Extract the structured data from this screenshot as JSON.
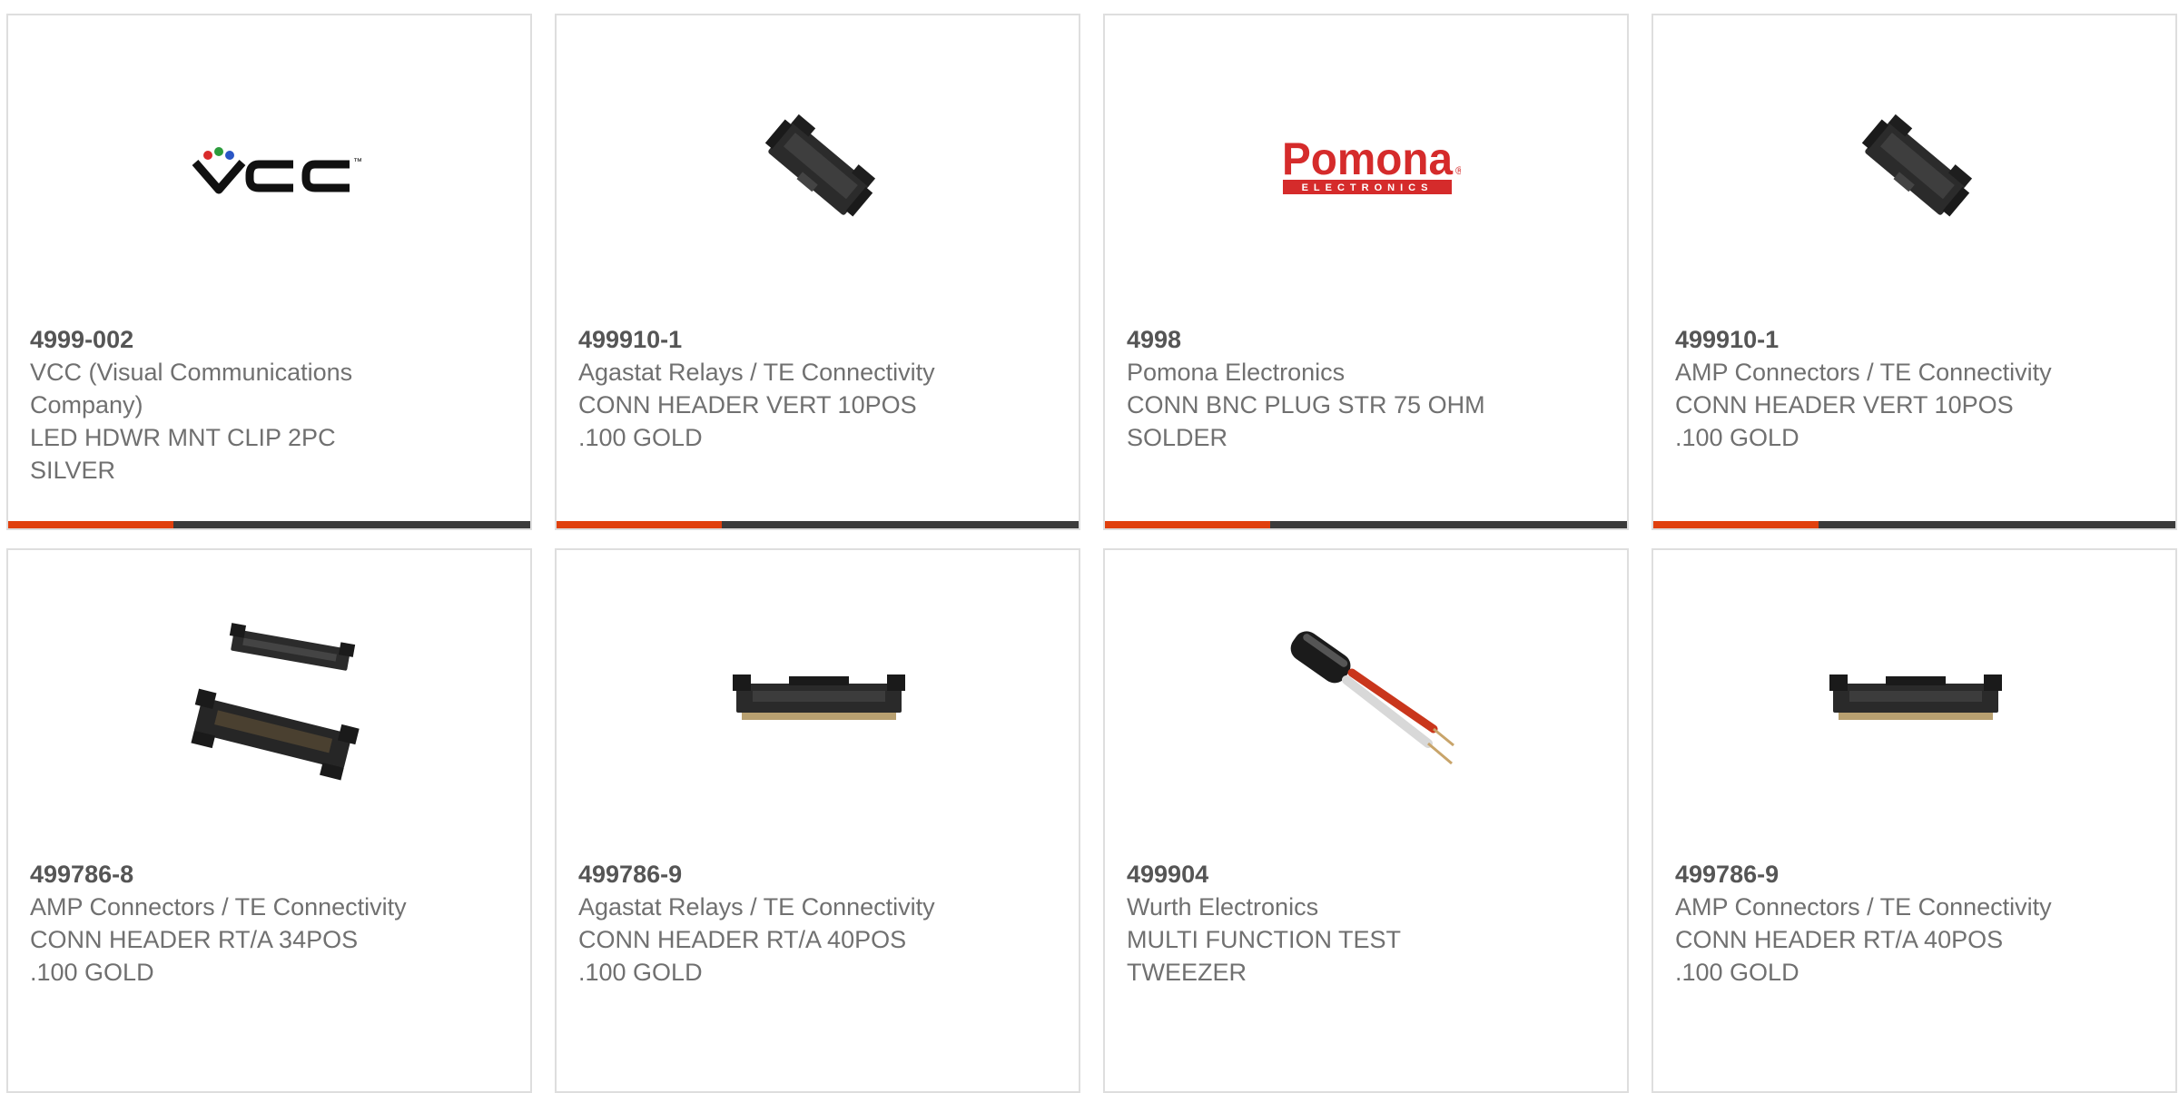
{
  "colors": {
    "accent": "#e0400e",
    "bar": "#3b3b3b",
    "border": "#dedede",
    "text": "#707070",
    "part_number": "#555555",
    "pomona_red": "#d52b2b"
  },
  "products": [
    {
      "part_number": "4999-002",
      "manufacturer": "VCC (Visual Communications Company)",
      "description": "LED HDWR MNT CLIP 2PC SILVER",
      "image": "vcc-logo"
    },
    {
      "part_number": "499910-1",
      "manufacturer": "Agastat Relays / TE Connectivity",
      "description": "CONN HEADER VERT 10POS .100 GOLD",
      "image": "vertical-header-connector"
    },
    {
      "part_number": "4998",
      "manufacturer": "Pomona Electronics",
      "description": "CONN BNC PLUG STR 75 OHM SOLDER",
      "image": "pomona-logo"
    },
    {
      "part_number": "499910-1",
      "manufacturer": "AMP Connectors / TE Connectivity",
      "description": "CONN HEADER VERT 10POS .100 GOLD",
      "image": "vertical-header-connector"
    },
    {
      "part_number": "499786-8",
      "manufacturer": "AMP Connectors / TE Connectivity",
      "description": "CONN HEADER RT/A 34POS .100 GOLD",
      "image": "two-right-angle-headers"
    },
    {
      "part_number": "499786-9",
      "manufacturer": "Agastat Relays / TE Connectivity",
      "description": "CONN HEADER RT/A 40POS .100 GOLD",
      "image": "right-angle-header"
    },
    {
      "part_number": "499904",
      "manufacturer": "Wurth Electronics",
      "description": "MULTI FUNCTION TEST TWEEZER",
      "image": "test-tweezer"
    },
    {
      "part_number": "499786-9",
      "manufacturer": "AMP Connectors / TE Connectivity",
      "description": "CONN HEADER RT/A 40POS .100 GOLD",
      "image": "right-angle-header"
    }
  ],
  "logos": {
    "vcc": "VCC",
    "vcc_tm": "™",
    "pomona": "Pomona",
    "pomona_sub": "ELECTRONICS",
    "pomona_reg": "®"
  }
}
